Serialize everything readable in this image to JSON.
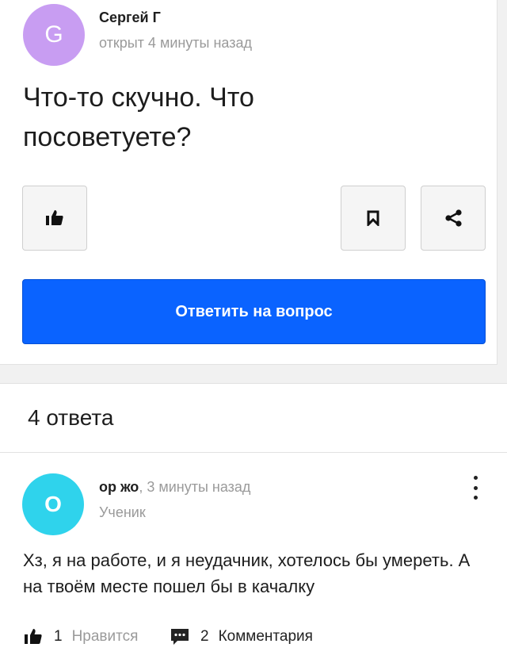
{
  "question": {
    "author": {
      "name": "Сергей Г",
      "avatar_letter": "G",
      "avatar_color": "#c89df2"
    },
    "meta": "открыт 4 минуты назад",
    "text": "Что-то скучно. Что посоветуете?",
    "buttons": {
      "like_icon": "thumbs-up-icon",
      "bookmark_icon": "bookmark-icon",
      "share_icon": "share-icon",
      "answer_label": "Ответить на вопрос"
    },
    "accent_color": "#0a63ff"
  },
  "answers": {
    "count_label": "4 ответа",
    "items": [
      {
        "author": {
          "name": "ор жо",
          "avatar_letter": "O",
          "avatar_color": "#2fd3ec"
        },
        "time": ", 3 минуты назад",
        "rank": "Ученик",
        "text": "Хз, я на работе, и я неудачник, хотелось бы умереть. А на твоём месте пошел бы в качалку",
        "likes": {
          "count": "1",
          "label": "Нравится"
        },
        "comments": {
          "count": "2",
          "label": "Комментария"
        }
      }
    ]
  }
}
